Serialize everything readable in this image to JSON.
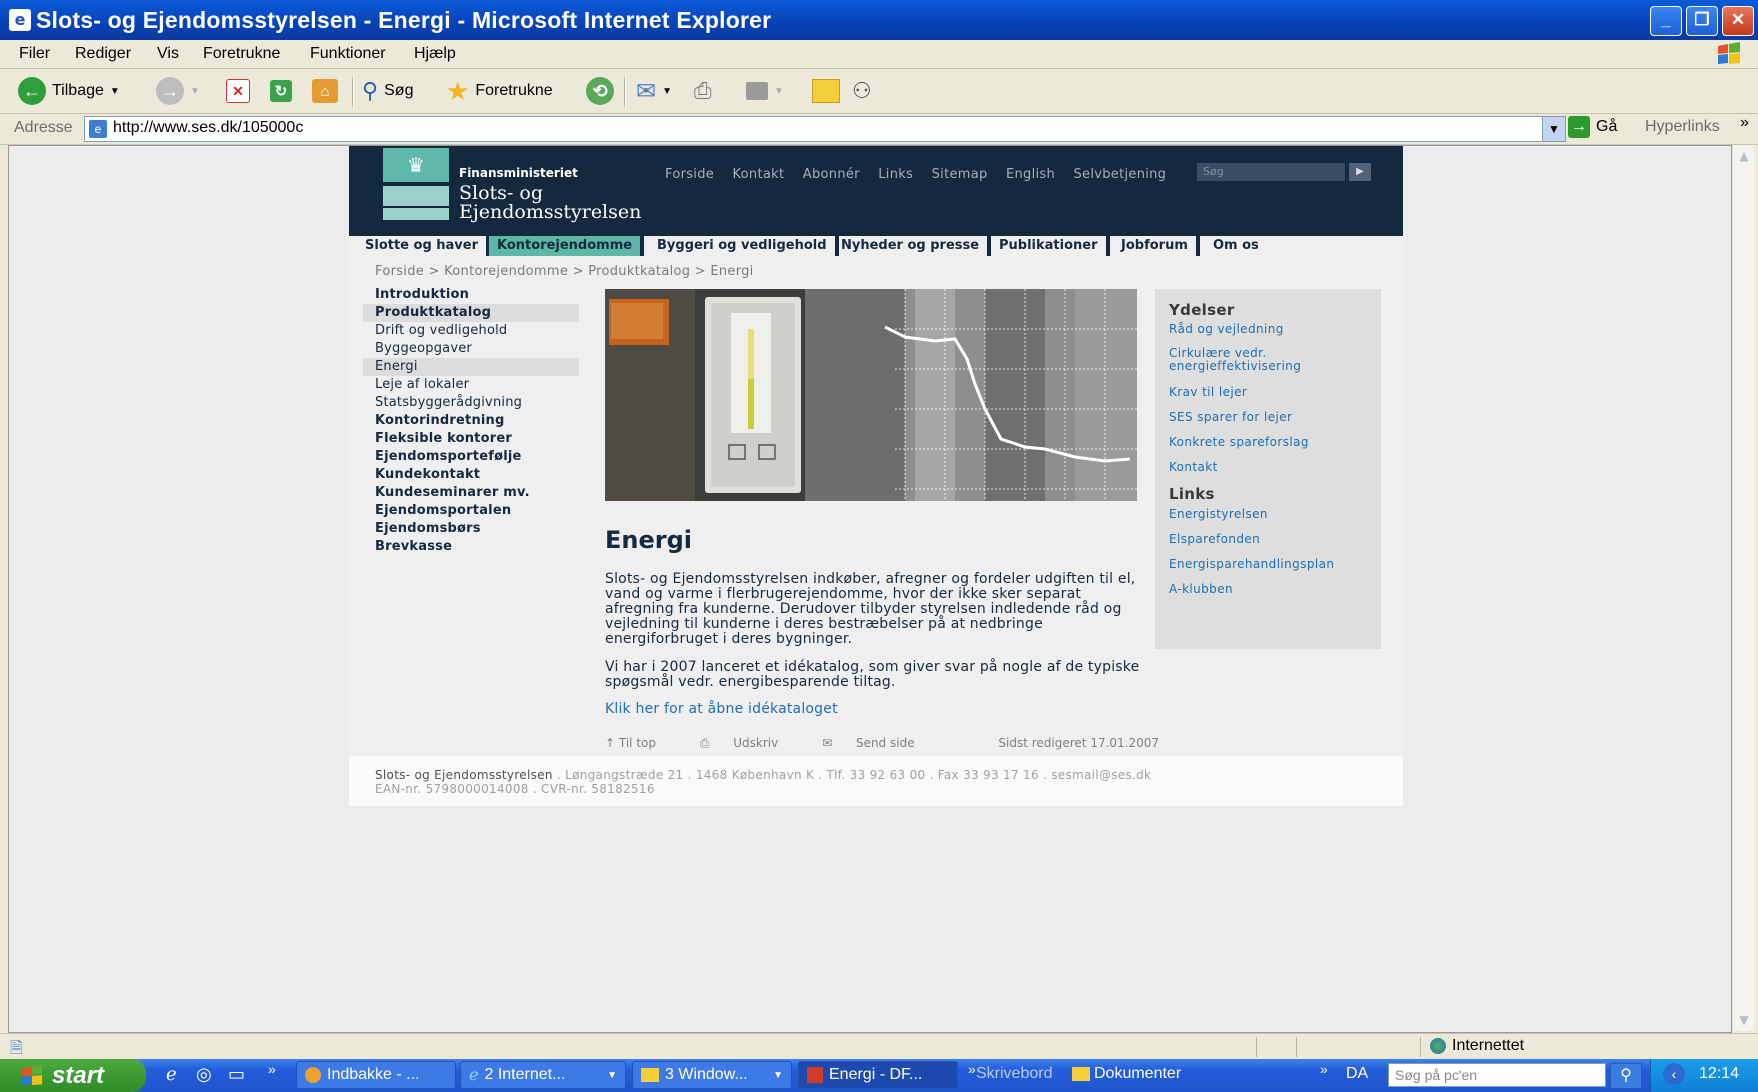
{
  "window": {
    "title": "Slots- og Ejendomsstyrelsen - Energi - Microsoft Internet Explorer"
  },
  "menu": [
    "Filer",
    "Rediger",
    "Vis",
    "Foretrukne",
    "Funktioner",
    "Hjælp"
  ],
  "toolbar": {
    "back": "Tilbage",
    "search": "Søg",
    "favorites": "Foretrukne"
  },
  "address": {
    "label": "Adresse",
    "url": "http://www.ses.dk/105000c",
    "go": "Gå",
    "links": "Hyperlinks"
  },
  "site": {
    "ministry": "Finansministeriet",
    "name_line1": "Slots- og",
    "name_line2": "Ejendomsstyrelsen",
    "topnav": [
      "Forside",
      "Kontakt",
      "Abonnér",
      "Links",
      "Sitemap",
      "English",
      "Selvbetjening"
    ],
    "search_placeholder": "Søg",
    "mainnav": [
      "Slotte og haver",
      "Kontorejendomme",
      "Byggeri og vedligehold",
      "Nyheder og presse",
      "Publikationer",
      "Jobforum",
      "Om os"
    ],
    "breadcrumb": "Forside > Kontorejendomme > Produktkatalog > Energi",
    "leftnav": [
      "Introduktion",
      "Produktkatalog",
      "Drift og vedligehold",
      "Byggeopgaver",
      "Energi",
      "Leje af lokaler",
      "Statsbyggerådgivning",
      "Kontorindretning",
      "Fleksible kontorer",
      "Ejendomsportefølje",
      "Kundekontakt",
      "Kundeseminarer mv.",
      "Ejendomsportalen",
      "Ejendomsbørs",
      "Brevkasse"
    ],
    "heading": "Energi",
    "para1": "Slots- og Ejendomsstyrelsen indkøber, afregner og fordeler udgiften til el, vand og varme i flerbrugerejendomme, hvor der ikke sker separat afregning fra kunderne. Derudover tilbyder styrelsen indledende råd og vejledning til kunderne i deres bestræbelser på at nedbringe energiforbruget i deres bygninger.",
    "para2": "Vi har i 2007 lanceret et idékatalog, som giver svar på nogle af de typiske spøgsmål vedr. energibesparende tiltag.",
    "catalog_link": "Klik her for at åbne idékataloget",
    "tools": {
      "top": "Til top",
      "print": "Udskriv",
      "send": "Send side",
      "edited": "Sidst redigeret 17.01.2007"
    },
    "sidebar": {
      "services_title": "Ydelser",
      "services": [
        "Råd og vejledning",
        "Cirkulære vedr. energieffektivisering",
        "Krav til lejer",
        "SES sparer for lejer",
        "Konkrete spareforslag",
        "Kontakt"
      ],
      "links_title": "Links",
      "links": [
        "Energistyrelsen",
        "Elsparefonden",
        "Energisparehandlingsplan",
        "A-klubben"
      ]
    },
    "footer": {
      "org": "Slots- og Ejendomsstyrelsen",
      "address": " . Løngangstræde 21 . 1468 København K . Tlf. 33 92 63 00 . Fax 33 93 17 16 . sesmail@ses.dk",
      "ids": "EAN-nr. 5798000014008 . CVR-nr. 58182516"
    }
  },
  "status": {
    "zone": "Internettet"
  },
  "taskbar": {
    "start": "start",
    "tasks": [
      "Indbakke - ...",
      "2 Internet...",
      "3 Window...",
      "Energi - DF..."
    ],
    "desktop": "Skrivebord",
    "documents": "Dokumenter",
    "lang": "DA",
    "search_placeholder": "Søg på pc'en",
    "clock": "12:14"
  },
  "colors": {
    "header": "#14283e",
    "accent": "#5db7a7",
    "link": "#1d6fb5"
  }
}
